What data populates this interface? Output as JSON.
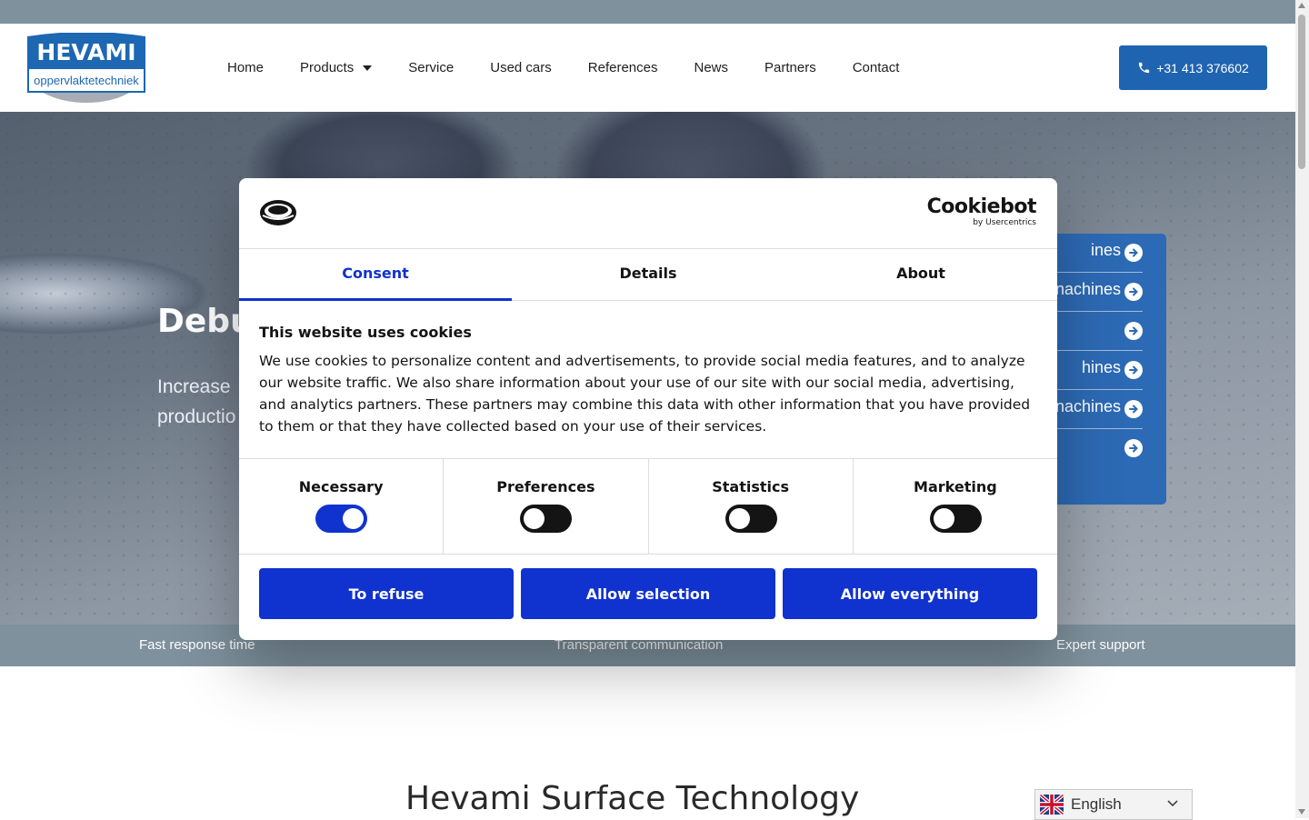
{
  "header": {
    "logo": {
      "name": "HEVAMI",
      "tagline": "oppervlaktetechniek"
    },
    "nav": [
      {
        "label": "Home"
      },
      {
        "label": "Products",
        "has_dropdown": true
      },
      {
        "label": "Service"
      },
      {
        "label": "Used cars"
      },
      {
        "label": "References"
      },
      {
        "label": "News"
      },
      {
        "label": "Partners"
      },
      {
        "label": "Contact"
      }
    ],
    "phone": "+31 413 376602",
    "phone_icon": "phone-icon"
  },
  "hero": {
    "title": "Debu",
    "subtitle": "Increase",
    "subtitle_line2": "productio",
    "side_items": [
      {
        "label": "ines"
      },
      {
        "label": "nachines"
      },
      {
        "label": ""
      },
      {
        "label": "hines"
      },
      {
        "label": "nachines"
      },
      {
        "label": ""
      }
    ]
  },
  "usp": [
    "Fast response time",
    "Transparent communication",
    "Expert support"
  ],
  "section": {
    "title": "Hevami Surface Technology"
  },
  "language": {
    "selected": "English"
  },
  "cookie_dialog": {
    "brand": "Cookiebot",
    "brand_sub": "by Usercentrics",
    "tabs": [
      "Consent",
      "Details",
      "About"
    ],
    "active_tab": "Consent",
    "heading": "This website uses cookies",
    "body": "We use cookies to personalize content and advertisements, to provide social media features, and to analyze our website traffic. We also share information about your use of our site with our social media, advertising, and analytics partners. These partners may combine this data with other information that you have provided to them or that they have collected based on your use of their services.",
    "categories": [
      {
        "label": "Necessary",
        "checked": true
      },
      {
        "label": "Preferences",
        "checked": false
      },
      {
        "label": "Statistics",
        "checked": false
      },
      {
        "label": "Marketing",
        "checked": false
      }
    ],
    "buttons": {
      "refuse": "To refuse",
      "selection": "Allow selection",
      "all": "Allow everything"
    },
    "accent": "#1032cf"
  }
}
